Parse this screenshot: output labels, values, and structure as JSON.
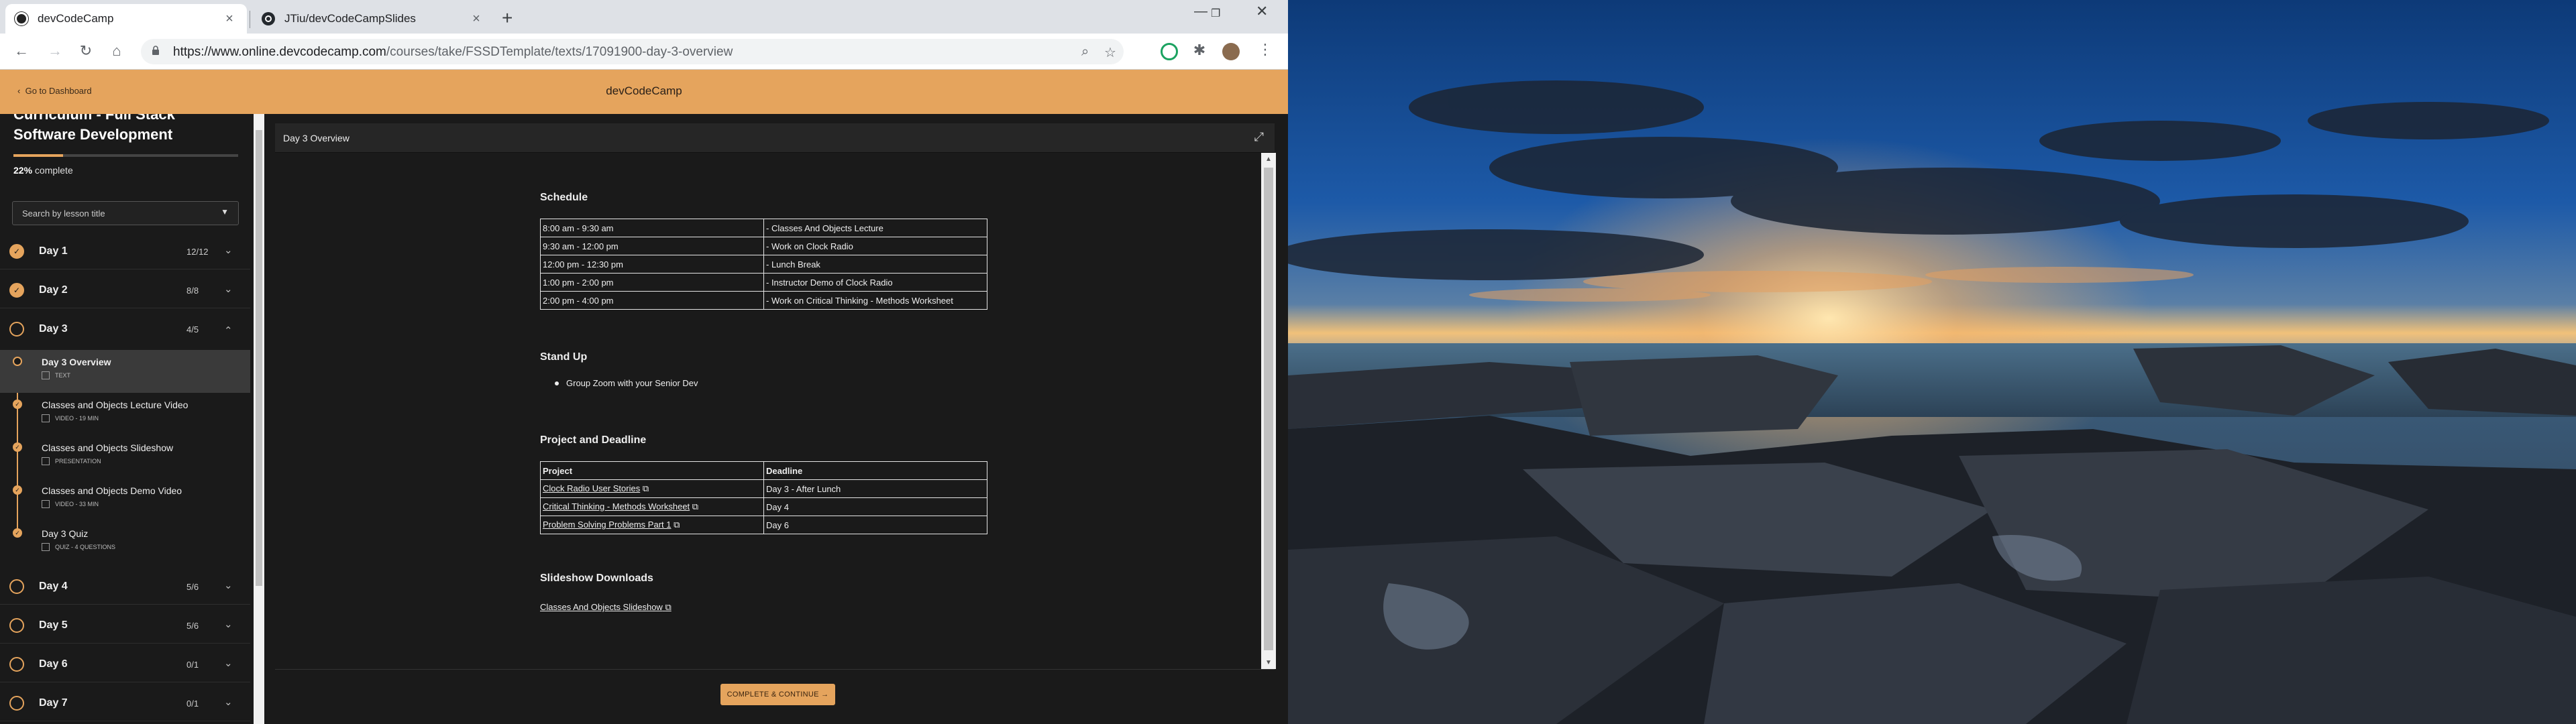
{
  "browser": {
    "tabs": [
      {
        "title": "devCodeCamp",
        "active": true
      },
      {
        "title": "JTiu/devCodeCampSlides",
        "active": false
      }
    ],
    "url_host": "https://www.online.devcodecamp.com",
    "url_path": "/courses/take/FSSDTemplate/texts/17091900-day-3-overview"
  },
  "header": {
    "back_link": "Go to Dashboard",
    "site_title": "devCodeCamp"
  },
  "sidebar": {
    "course_title": "Curriculum - Full Stack Software Development",
    "progress_percent": 22,
    "progress_text_value": "22%",
    "progress_text_suffix": "complete",
    "search_placeholder": "Search by lesson title",
    "days_top": [
      {
        "label": "Day 1",
        "count": "12/12",
        "complete": true
      },
      {
        "label": "Day 2",
        "count": "8/8",
        "complete": true
      },
      {
        "label": "Day 3",
        "count": "4/5",
        "complete": false
      }
    ],
    "lessons": [
      {
        "name": "Day 3 Overview",
        "meta": "TEXT",
        "current": true
      },
      {
        "name": "Classes and Objects Lecture Video",
        "meta": "VIDEO - 19 MIN",
        "current": false
      },
      {
        "name": "Classes and Objects Slideshow",
        "meta": "PRESENTATION",
        "current": false
      },
      {
        "name": "Classes and Objects Demo Video",
        "meta": "VIDEO - 33 MIN",
        "current": false
      },
      {
        "name": "Day 3 Quiz",
        "meta": "QUIZ - 4 QUESTIONS",
        "current": false
      }
    ],
    "days_bottom": [
      {
        "label": "Day 4",
        "count": "5/6"
      },
      {
        "label": "Day 5",
        "count": "5/6"
      },
      {
        "label": "Day 6",
        "count": "0/1"
      },
      {
        "label": "Day 7",
        "count": "0/1"
      }
    ]
  },
  "content": {
    "panel_title": "Day 3 Overview",
    "schedule_heading": "Schedule",
    "schedule": [
      [
        "8:00 am - 9:30 am",
        "- Classes And Objects Lecture"
      ],
      [
        "9:30 am - 12:00 pm",
        "- Work on Clock Radio"
      ],
      [
        "12:00 pm - 12:30 pm",
        "- Lunch Break"
      ],
      [
        "1:00 pm - 2:00 pm",
        "- Instructor Demo of Clock Radio"
      ],
      [
        "2:00 pm - 4:00 pm",
        "- Work on Critical Thinking - Methods Worksheet"
      ]
    ],
    "standup_heading": "Stand Up",
    "standup_item": "Group Zoom with your Senior Dev",
    "project_heading": "Project and Deadline",
    "project_header": [
      "Project",
      "Deadline"
    ],
    "projects": [
      [
        "Clock Radio User Stories",
        "Day 3 - After Lunch"
      ],
      [
        "Critical Thinking - Methods Worksheet",
        "Day 4"
      ],
      [
        "Problem Solving Problems Part 1",
        "Day 6"
      ]
    ],
    "downloads_heading": "Slideshow Downloads",
    "download_link": "Classes And Objects Slideshow",
    "complete_button": "COMPLETE & CONTINUE →"
  }
}
